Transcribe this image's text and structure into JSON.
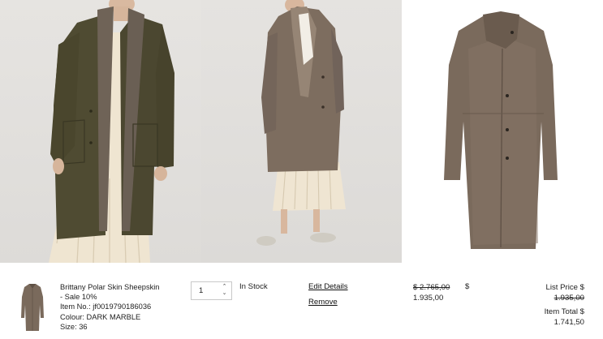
{
  "item": {
    "name_line1": "Brittany Polar Skin Sheepskin",
    "name_line2": "- Sale 10%",
    "item_no": "Item No.: jf0019790186036",
    "colour": "Colour: DARK MARBLE",
    "size": "Size: 36"
  },
  "quantity": {
    "value": "1",
    "up_arrow": "^",
    "down_arrow": "v"
  },
  "stock_status": "In Stock",
  "actions": {
    "edit": "Edit Details",
    "remove": "Remove"
  },
  "price": {
    "original": "$ 2.765,00",
    "currency": "$",
    "sale": "1.935,00"
  },
  "totals": {
    "list_price_label": "List Price $",
    "list_price_value": "1.935,00",
    "item_total_label": "Item Total $",
    "item_total_value": "1.741,50"
  },
  "colors": {
    "olive_leather": "#4f4b32",
    "sheepskin": "#7a6a5c",
    "dress": "#f0e6d2",
    "background": "#e2e0dd"
  }
}
